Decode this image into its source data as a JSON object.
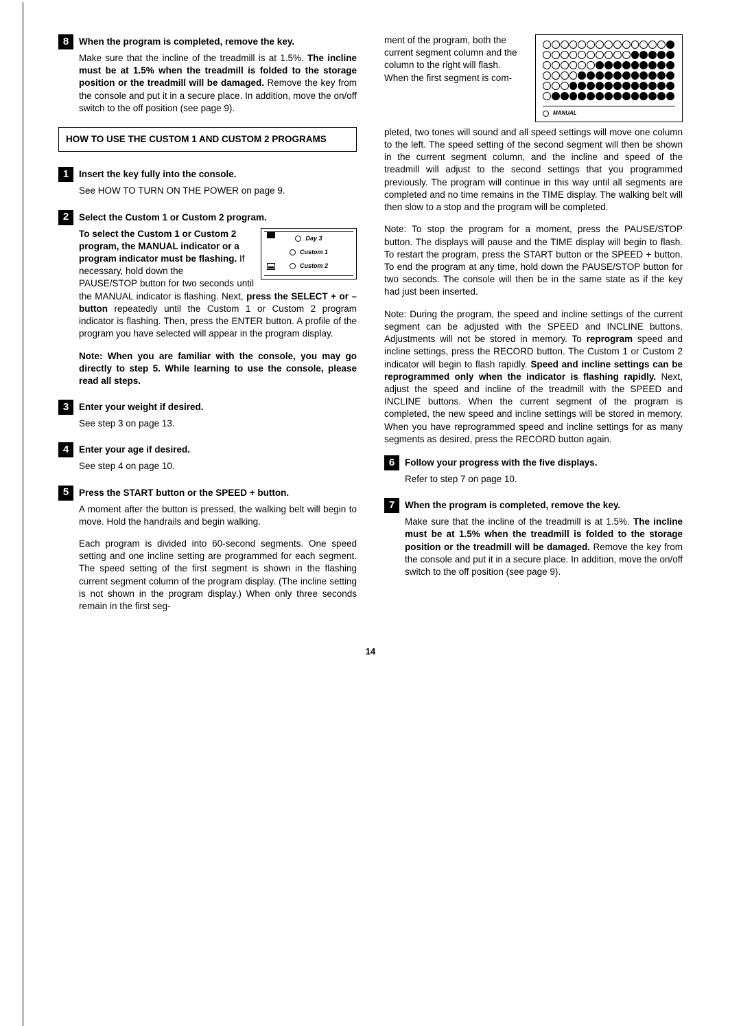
{
  "left": {
    "step8": {
      "num": "8",
      "title": "When the program is completed, remove the key.",
      "body": "Make sure that the incline of the treadmill is at 1.5%. <b>The incline must be at 1.5% when the treadmill is folded to the storage position or the treadmill will be damaged.</b> Remove the key from the console and put it in a secure place. In addition, move the on/off switch to the off position (see page 9)."
    },
    "box_heading": "HOW TO USE THE CUSTOM 1 AND CUSTOM 2 PROGRAMS",
    "step1": {
      "num": "1",
      "title": "Insert the key fully into the console.",
      "body": "See HOW TO TURN ON THE POWER on page 9."
    },
    "step2": {
      "num": "2",
      "title": "Select the Custom 1 or Custom 2  program.",
      "lead": "<b>To select the Custom 1 or Custom 2 program, the MANUAL indicator or a program indicator must be flashing.</b> If necessary, hold down the",
      "cont": "PAUSE/STOP button for two seconds until the MANUAL indicator is flashing. Next, <b>press the SELECT + or – button</b> repeatedly until the Custom 1 or Custom 2 program indicator is flashing. Then, press the ENTER button. A profile of the program you have selected will appear in the program display.",
      "note": "Note: When you are familiar with the console, you may go directly to step 5. While learning to use the console, please read all steps.",
      "fig": {
        "row1": "Day 3",
        "row2": "Custom 1",
        "row3": "Custom 2"
      }
    },
    "step3": {
      "num": "3",
      "title": "Enter your weight if desired.",
      "body": "See step 3 on page 13."
    },
    "step4": {
      "num": "4",
      "title": "Enter your age if desired.",
      "body": "See step 4 on page 10."
    },
    "step5": {
      "num": "5",
      "title": "Press the START button or the SPEED + button.",
      "p1": "A moment after the button is pressed, the walking belt will begin to move. Hold the handrails and begin walking.",
      "p2": "Each program is divided into 60-second segments. One speed setting and one incline setting are programmed for each segment. The speed setting of the first segment is shown in the flashing current segment column of the program display. (The incline setting is not shown in the program display.) When only three seconds remain in the first seg-"
    }
  },
  "right": {
    "cont1_lead": "ment of the program, both the current segment column and the column to the right will flash. When the first segment is com-",
    "cont1_rest": "pleted, two tones will sound and all speed settings will move one column to the left. The speed setting of the second segment will then be shown in the current segment column, and the incline and speed of the treadmill will adjust to the second settings that you programmed previously. The program will continue in this way until all segments are completed and no time remains in the TIME display. The walking belt will then slow to a stop and the program will be completed.",
    "cont2": "Note: To stop the program for a moment, press the PAUSE/STOP button. The displays will pause and the TIME display will begin to flash. To restart the program, press the START button or the SPEED + button. To end the program at any time, hold down the PAUSE/STOP button for two seconds. The console will then be in the same state as if the key had just been inserted.",
    "cont3": "Note: During the program, the speed and incline settings of the current segment can be adjusted with the SPEED and INCLINE buttons. Adjustments will not be stored in memory. To <b>reprogram</b> speed and incline settings, press the RECORD button. The Custom 1 or Custom 2 indicator will begin to flash rapidly. <b>Speed and incline settings can be reprogrammed only when the indicator is flashing rapidly.</b> Next, adjust the speed and incline of the treadmill with the SPEED and INCLINE buttons. When the current segment of the program is completed, the new speed and incline settings will be stored in memory. When you have reprogrammed speed and incline settings for as many segments as desired, press the RECORD button again.",
    "manual_label": "MANUAL",
    "step6": {
      "num": "6",
      "title": "Follow your progress with the five displays.",
      "body": "Refer to step 7 on page 10."
    },
    "step7": {
      "num": "7",
      "title": "When the program is completed, remove the key.",
      "body": "Make sure that the incline of the treadmill is at 1.5%. <b>The incline must be at 1.5% when the treadmill is folded to the storage position or the treadmill will be damaged.</b> Remove the key from the console and put it in a secure place. In addition, move the on/off switch to the off position (see page 9)."
    }
  },
  "page_number": "14",
  "chart_data": {
    "type": "table",
    "rows": 6,
    "cols": 15,
    "filled_start_col": [
      15,
      11,
      7,
      5,
      4,
      2
    ],
    "description": "LED program profile matrix; filled dots from given start column to end; vertical marker between columns 2 and 3."
  }
}
